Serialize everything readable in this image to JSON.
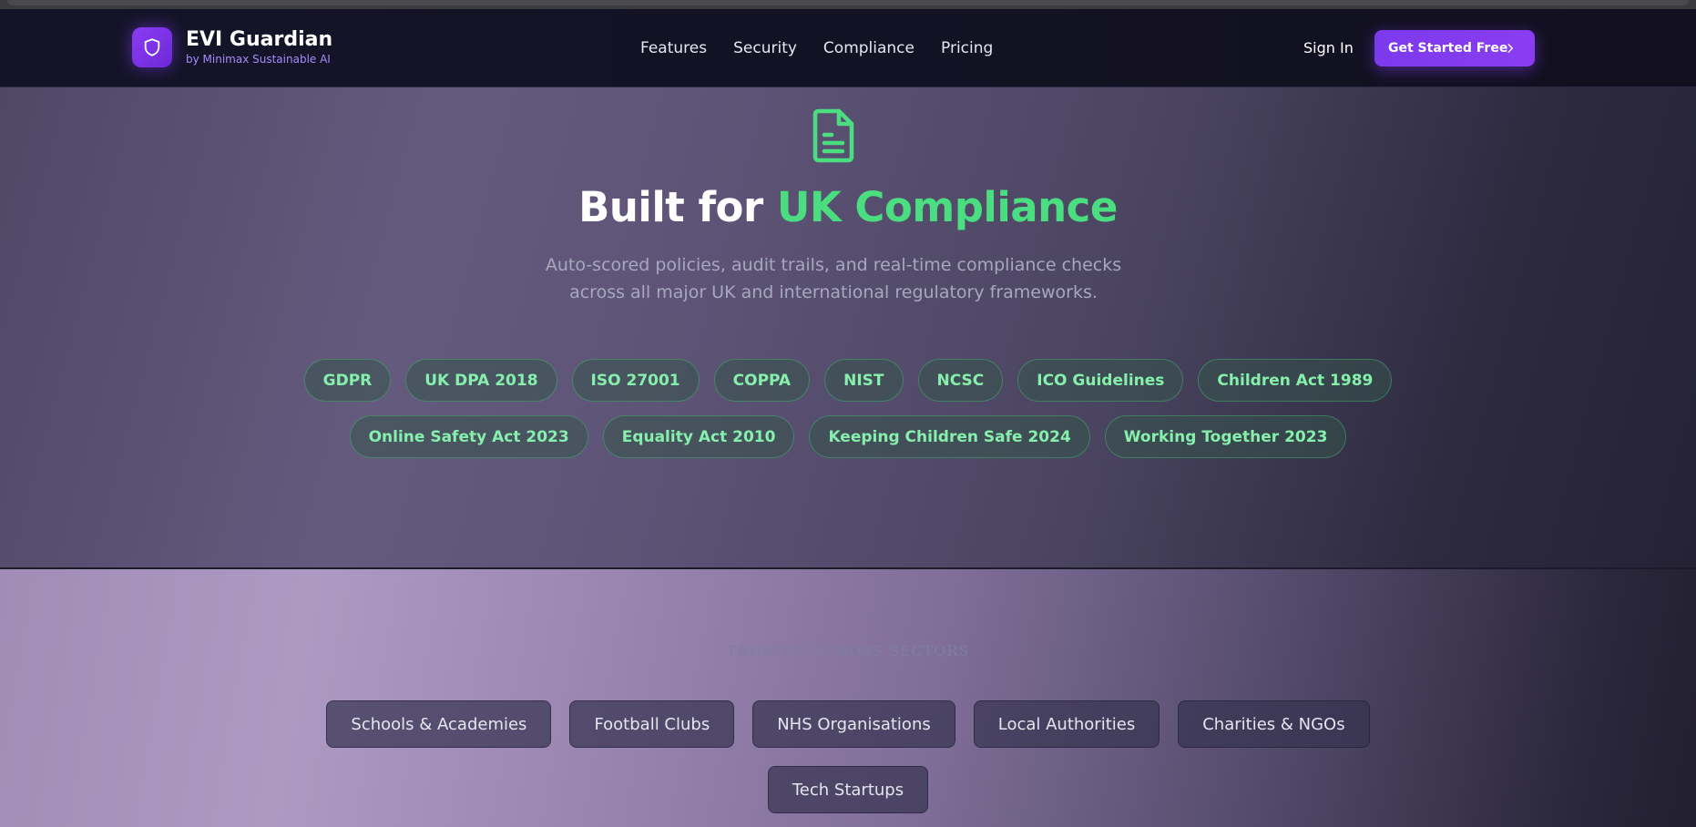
{
  "header": {
    "brand_name": "EVI Guardian",
    "brand_sub": "by Minimax Sustainable AI",
    "nav": [
      "Features",
      "Security",
      "Compliance",
      "Pricing"
    ],
    "signin": "Sign In",
    "cta": "Get Started Free"
  },
  "hero": {
    "title_prefix": "Built for ",
    "title_accent": "UK Compliance",
    "subtitle": "Auto-scored policies, audit trails, and real-time compliance checks across all major UK and international regulatory frameworks.",
    "frameworks_row1": [
      "GDPR",
      "UK DPA 2018",
      "ISO 27001",
      "COPPA",
      "NIST",
      "NCSC",
      "ICO Guidelines",
      "Children Act 1989"
    ],
    "frameworks_row2": [
      "Online Safety Act 2023",
      "Equality Act 2010",
      "Keeping Children Safe 2024",
      "Working Together 2023"
    ]
  },
  "trusted": {
    "label": "TRUSTED ACROSS SECTORS",
    "sectors_row1": [
      "Schools & Academies",
      "Football Clubs",
      "NHS Organisations",
      "Local Authorities",
      "Charities & NGOs"
    ],
    "sectors_row2": [
      "Tech Startups"
    ]
  },
  "icons": {
    "brand": "shield-icon",
    "hero": "document-icon",
    "cta": "chevron-right-icon"
  },
  "colors": {
    "accent_purple": "#7c3aed",
    "accent_green": "#4ade80",
    "nav_bg": "#131224"
  }
}
